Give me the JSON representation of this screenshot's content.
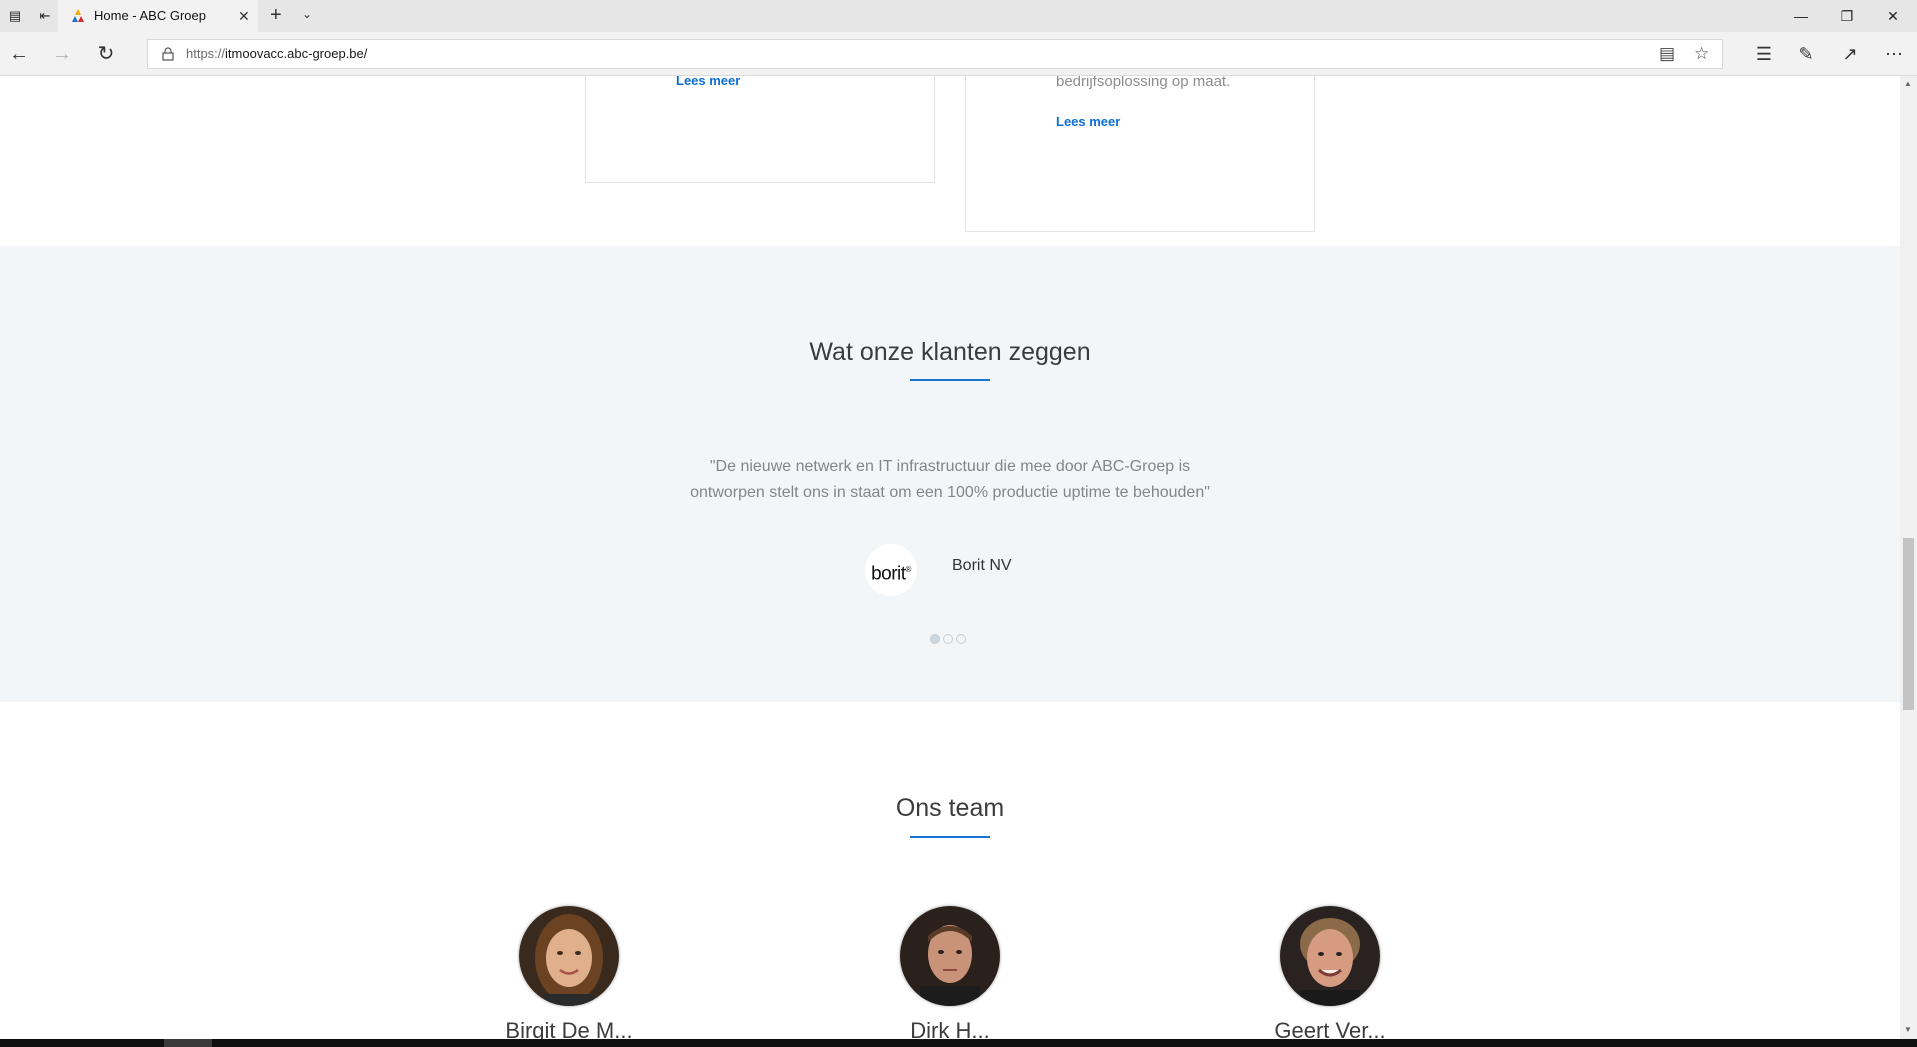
{
  "browser": {
    "tab_title": "Home - ABC Groep",
    "url_protocol": "https://",
    "url_host": "itmoovacc.abc-groep.be/",
    "colors": {
      "tabbar": "#e6e6e6",
      "active_tab": "#f2f2f2"
    }
  },
  "cards": {
    "left_link": "Lees meer",
    "right_text": "bedrijfsoplossing op maat.",
    "right_link": "Lees meer"
  },
  "testimonials": {
    "title": "Wat onze klanten zeggen",
    "quote": "\"De nieuwe netwerk en IT infrastructuur die mee door ABC-Groep is ontworpen stelt ons in staat om een 100% productie uptime te behouden\"",
    "client_logo_text": "borit",
    "client_name": "Borit NV",
    "slide_count": 3,
    "active_slide": 1
  },
  "team": {
    "title": "Ons team",
    "members": [
      {
        "name": "Birgit De M..."
      },
      {
        "name": "Dirk H..."
      },
      {
        "name": "Geert Ver..."
      }
    ]
  },
  "theme": {
    "accent": "#1b73d1",
    "link": "#0b6fd6",
    "section_bg": "#f3f6f8"
  }
}
